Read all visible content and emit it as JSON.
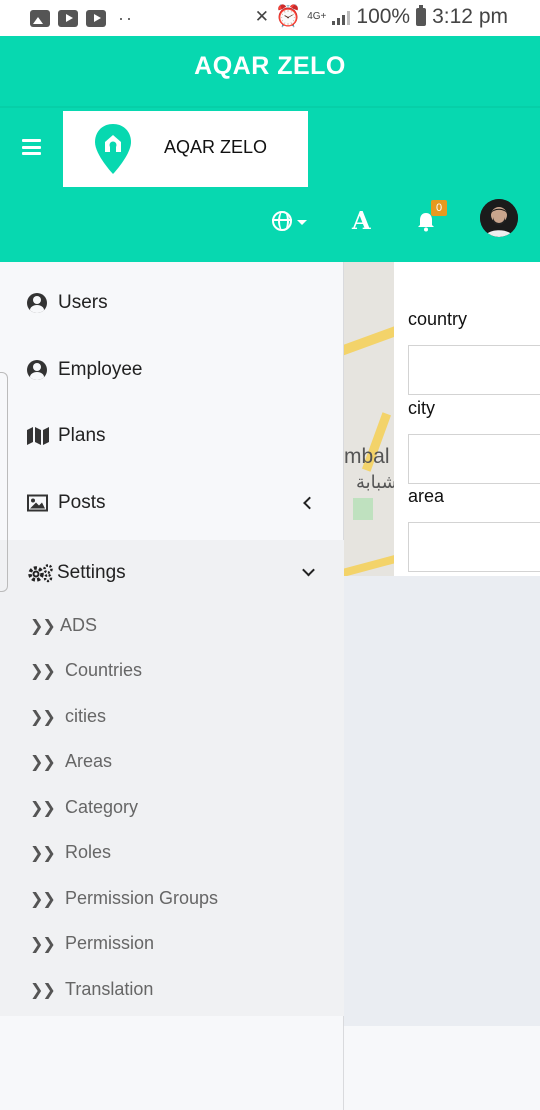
{
  "status_bar": {
    "battery": "100%",
    "time": "3:12 pm",
    "network": "4G+",
    "left_icons": [
      "image-icon",
      "youtube-icon",
      "youtube-icon"
    ],
    "dots": "··"
  },
  "header": {
    "title": "AQAR ZELO",
    "brand_name": "AQAR ZELO",
    "notification_count": "0",
    "font_toggle": "A",
    "accent_color": "#07d8b0",
    "badge_color": "#e59a1f"
  },
  "sidebar": {
    "items": [
      {
        "label": "Users",
        "icon": "user-circle-icon"
      },
      {
        "label": "Employee",
        "icon": "user-circle-icon"
      },
      {
        "label": "Plans",
        "icon": "map-icon"
      },
      {
        "label": "Posts",
        "icon": "image-icon"
      },
      {
        "label": "Settings",
        "icon": "cogs-icon"
      }
    ],
    "settings_sub": [
      "ADS",
      "Countries",
      "cities",
      "Areas",
      "Category",
      "Roles",
      "Permission Groups",
      "Permission",
      "Translation"
    ],
    "sub_icon": "double-chevron-right-icon"
  },
  "map": {
    "text_latin": "mbal",
    "text_arabic": "شبابة"
  },
  "form": {
    "fields": [
      {
        "label": "country"
      },
      {
        "label": "city"
      },
      {
        "label": "area"
      }
    ]
  }
}
